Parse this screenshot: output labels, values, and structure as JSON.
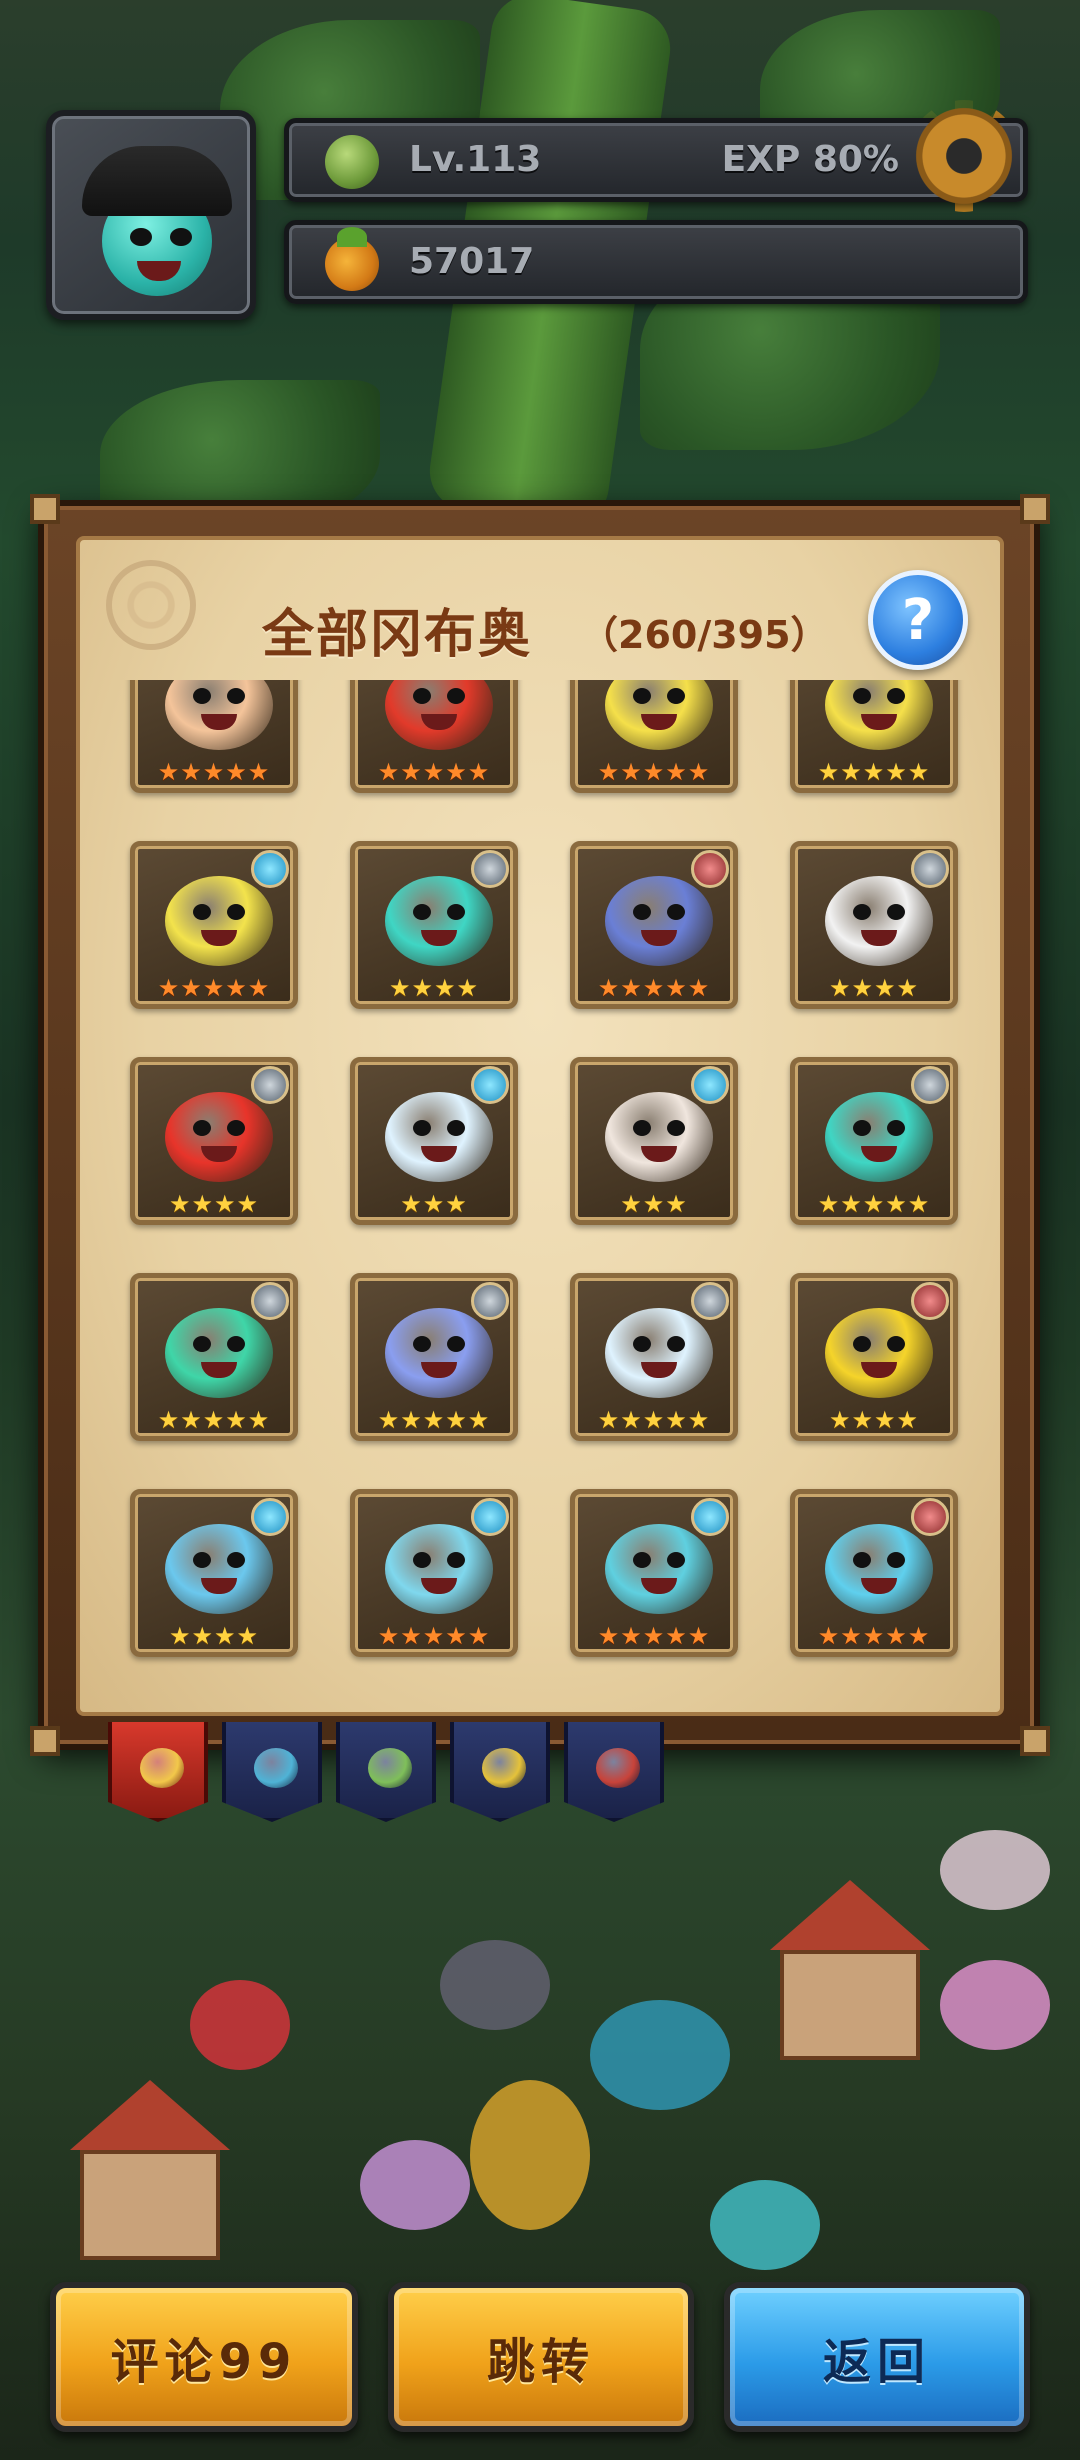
{
  "hud": {
    "level_label": "Lv.113",
    "exp_label": "EXP 80%",
    "exp_progress": 0.8,
    "coins": "57017",
    "level_icon": "artichoke-icon",
    "coin_icon": "fruit-currency-icon",
    "settings_icon": "gear-icon"
  },
  "panel": {
    "title": "全部冈布奥",
    "count": "（260/395）",
    "help_label": "?",
    "emblem_icon": "emblem-icon"
  },
  "cards": [
    {
      "stars": "★★★★★",
      "star_color": "orange",
      "body": "#f4c49a",
      "badge": ""
    },
    {
      "stars": "★★★★★",
      "star_color": "orange",
      "body": "#e23a2a",
      "badge": ""
    },
    {
      "stars": "★★★★★",
      "star_color": "orange",
      "body": "#f5e04a",
      "badge": ""
    },
    {
      "stars": "★★★★★",
      "star_color": "gold",
      "body": "#f5e04a",
      "badge": ""
    },
    {
      "stars": "★★★★★",
      "star_color": "orange",
      "body": "#f3e34c",
      "badge": "blue"
    },
    {
      "stars": "★★★★",
      "star_color": "gold",
      "body": "#3fd6c4",
      "badge": "gray"
    },
    {
      "stars": "★★★★★",
      "star_color": "orange",
      "body": "#6a7fd6",
      "badge": "red"
    },
    {
      "stars": "★★★★",
      "star_color": "gold",
      "body": "#f2f2f2",
      "badge": "gray"
    },
    {
      "stars": "★★★★",
      "star_color": "gold",
      "body": "#e8342a",
      "badge": "gray"
    },
    {
      "stars": "★★★",
      "star_color": "gold",
      "body": "#dff3ff",
      "badge": "blue"
    },
    {
      "stars": "★★★",
      "star_color": "gold",
      "body": "#f0e6de",
      "badge": "blue"
    },
    {
      "stars": "★★★★★",
      "star_color": "gold",
      "body": "#3fd6c4",
      "badge": "gray"
    },
    {
      "stars": "★★★★★",
      "star_color": "gold",
      "body": "#3fd6a8",
      "badge": "gray"
    },
    {
      "stars": "★★★★★",
      "star_color": "gold",
      "body": "#8a9ef0",
      "badge": "gray"
    },
    {
      "stars": "★★★★★",
      "star_color": "gold",
      "body": "#dff3ff",
      "badge": "gray"
    },
    {
      "stars": "★★★★",
      "star_color": "gold",
      "body": "#f5d42a",
      "badge": "red"
    },
    {
      "stars": "★★★★",
      "star_color": "gold",
      "body": "#6bc8ee",
      "badge": "blue"
    },
    {
      "stars": "★★★★★",
      "star_color": "orange",
      "body": "#7fd8ee",
      "badge": "blue"
    },
    {
      "stars": "★★★★★",
      "star_color": "orange",
      "body": "#5fd0e0",
      "badge": "blue"
    },
    {
      "stars": "★★★★★",
      "star_color": "orange",
      "body": "#5fd0ee",
      "badge": "red"
    }
  ],
  "tabs": [
    {
      "name": "tab-all",
      "active": true,
      "icon": "#f2c84a"
    },
    {
      "name": "tab-blue",
      "active": false,
      "icon": "#4fb3d6"
    },
    {
      "name": "tab-green",
      "active": false,
      "icon": "#7fbf5a"
    },
    {
      "name": "tab-yellow",
      "active": false,
      "icon": "#e5c23a"
    },
    {
      "name": "tab-red",
      "active": false,
      "icon": "#c8433a"
    }
  ],
  "buttons": {
    "comments_label": "评论99",
    "jump_label": "跳转",
    "back_label": "返回"
  },
  "colors": {
    "gold_button": "#f0a21a",
    "blue_button": "#2b9be8",
    "title": "#7a3a14",
    "panel_paper": "#e8d2a4"
  }
}
